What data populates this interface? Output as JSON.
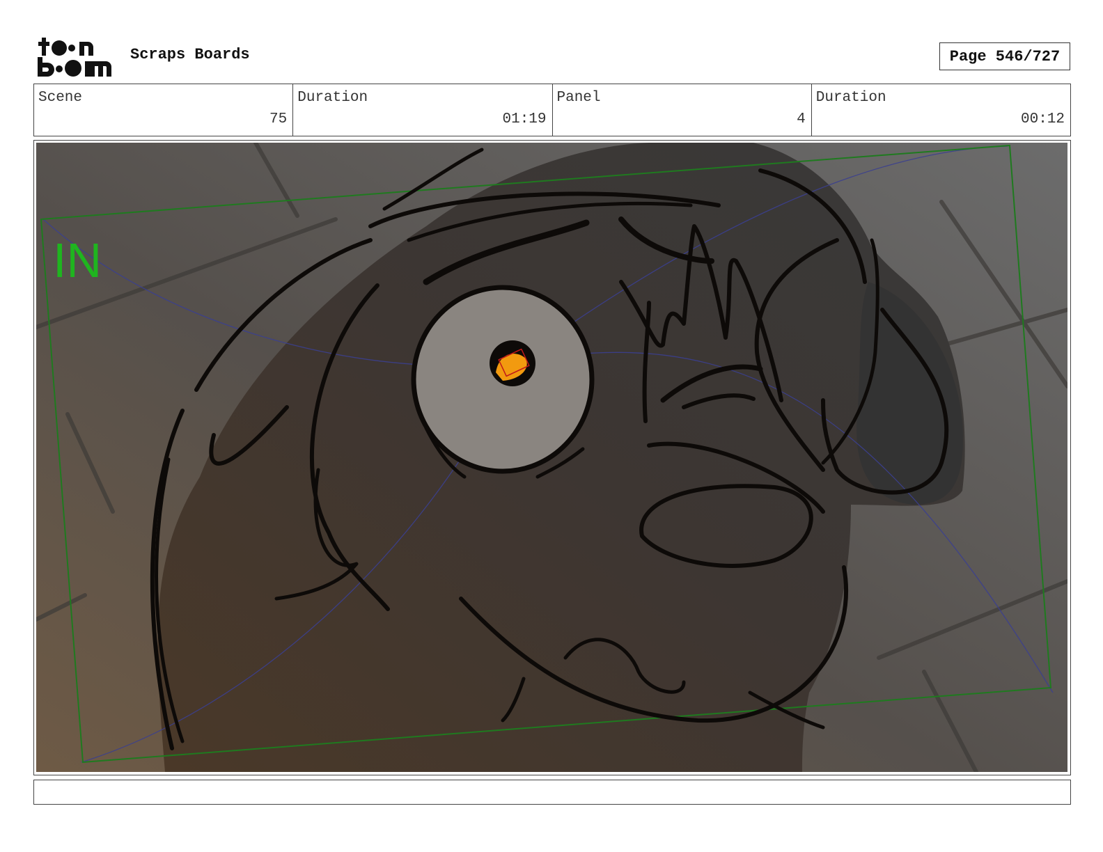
{
  "header": {
    "logo_text": "toon boom",
    "title": "Scraps Boards",
    "page_label": "Page 546/727"
  },
  "info": [
    {
      "label": "Scene",
      "value": "75"
    },
    {
      "label": "Duration",
      "value": "01:19"
    },
    {
      "label": "Panel",
      "value": "4"
    },
    {
      "label": "Duration",
      "value": "00:12"
    }
  ],
  "panel": {
    "camera_label": "IN",
    "colors": {
      "camera_frame": "#1f7a1f",
      "camera_label": "#1fb51f",
      "guide_lines": "#3b3f8f",
      "ink": "#0d0a08",
      "eye_white": "#8a8580",
      "pupil_fire": "#f29a0f",
      "bg_light": "#6f6f6f",
      "bg_warm": "#6a5440"
    }
  },
  "notes": {
    "text": ""
  }
}
